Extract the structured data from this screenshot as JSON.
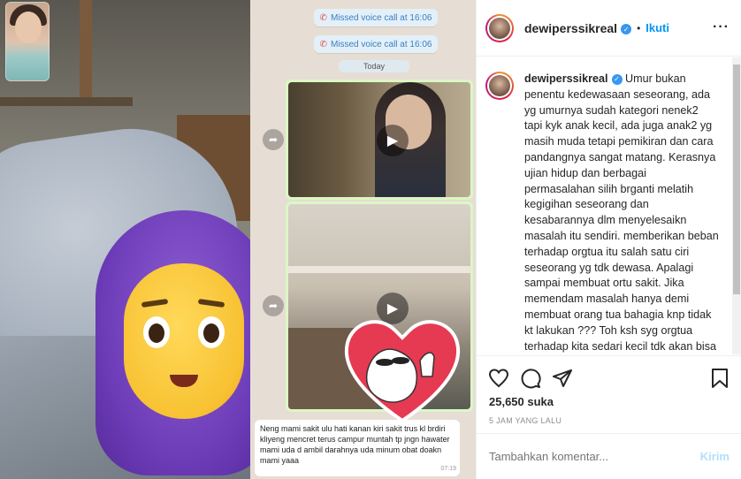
{
  "chat": {
    "missed_calls": [
      "Missed voice call at 16:06",
      "Missed voice call at 16:06"
    ],
    "date_divider": "Today",
    "message": "Neng mami sakit ulu hati kanan kiri sakit trus kl brdiri kliyeng mencret terus campur muntah tp jngn hawater mami uda d ambil darahnya uda minum obat doakn mami yaaa",
    "message_time": "07:19"
  },
  "post": {
    "username": "dewiperssikreal",
    "follow_separator": "•",
    "follow_label": "Ikuti",
    "more_icon": "more-options-icon",
    "caption": "Umur bukan penentu kedewasaan seseorang, ada yg umurnya sudah kategori nenek2 tapi kyk anak kecil, ada juga anak2 yg masih muda tetapi pemikiran dan cara pandangnya sangat matang. Kerasnya ujian hidup dan berbagai permasalahan silih brganti melatih kegigihan seseorang dan kesabarannya dlm menyelesaikn masalah itu sendiri. memberikan beban terhadap orgtua itu salah satu ciri seseorang yg tdk dewasa. Apalagi sampai membuat ortu sakit. Jika memendam masalah hanya demi membuat orang tua bahagia knp tidak kt lakukan ??? Toh ksh syg orgtua terhadap kita sedari kecil tdk akan bisa terbayar oleh kita dg apapun. Apalgi sampai membuat",
    "likes": "25,650 suka",
    "time_ago": "5 JAM YANG LALU",
    "comment_placeholder": "Tambahkan komentar...",
    "post_label": "Kirim",
    "accent_color": "#0095f6"
  }
}
